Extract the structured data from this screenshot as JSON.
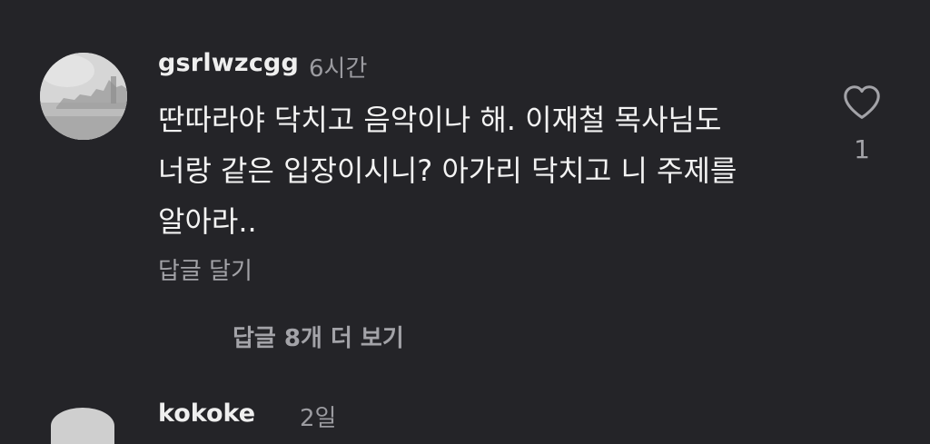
{
  "comment": {
    "username": "gsrlwzcgg",
    "time": "6시간",
    "text": "딴따라야 닥치고 음악이나 해. 이재철 목사님도\n너랑 같은 입장이시니? 아가리 닥치고 니 주제를\n알아라..",
    "reply_label": "답글 달기",
    "like_count": "1",
    "view_replies_label": "답글 8개 더 보기",
    "icons": {
      "avatar": "avatar",
      "like": "heart-outline-icon"
    }
  },
  "next_comment": {
    "username": "kokoke",
    "time": "2일"
  },
  "colors": {
    "background": "#242428",
    "primary_text": "#f3f3f3",
    "secondary_text": "#a3a3a8"
  }
}
